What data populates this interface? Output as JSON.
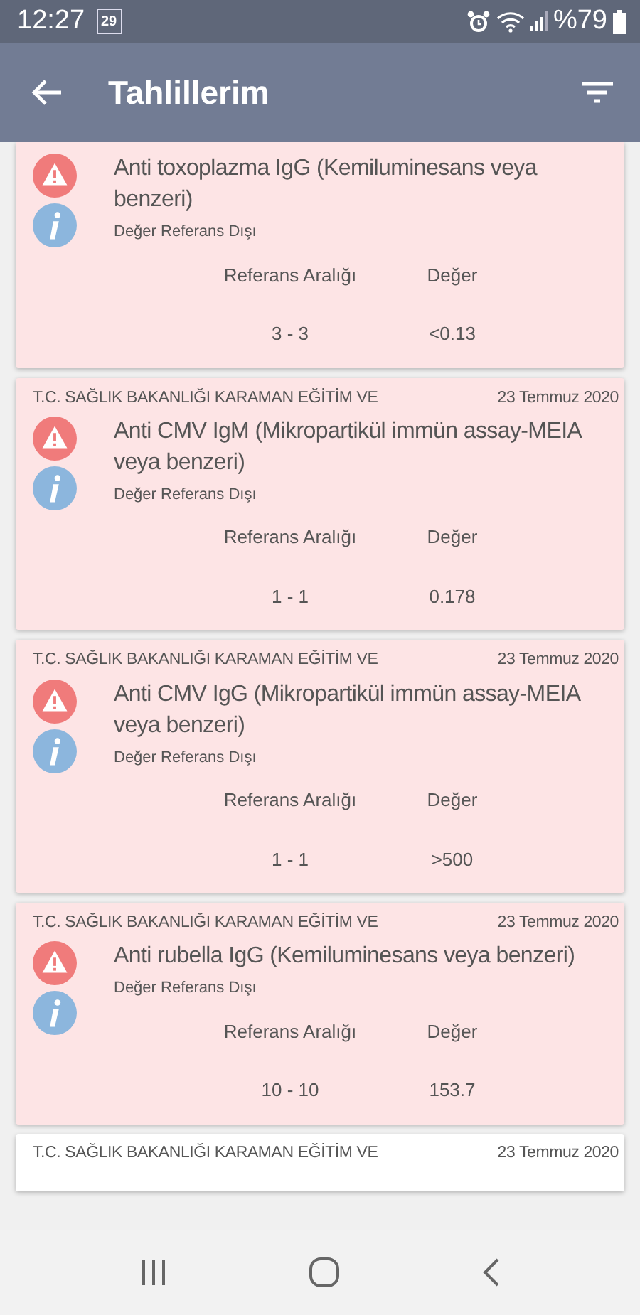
{
  "status_bar": {
    "time": "12:27",
    "calendar_day": "29",
    "battery": "%79"
  },
  "app_bar": {
    "title": "Tahlillerim"
  },
  "results": [
    {
      "flagged": true,
      "test": "Anti toxoplazma IgG (Kemiluminesans veya benzeri)",
      "status": "Değer Referans Dışı",
      "range_label": "Referans Aralığı",
      "value_label": "Değer",
      "range": "3 - 3",
      "value": "<0.13"
    },
    {
      "hospital": "T.C. SAĞLIK BAKANLIĞI KARAMAN EĞİTİM VE",
      "date": "23 Temmuz 2020",
      "flagged": true,
      "test": "Anti CMV IgM (Mikropartikül immün assay-MEIA veya benzeri)",
      "status": "Değer Referans Dışı",
      "range_label": "Referans Aralığı",
      "value_label": "Değer",
      "range": "1 - 1",
      "value": "0.178"
    },
    {
      "hospital": "T.C. SAĞLIK BAKANLIĞI KARAMAN EĞİTİM VE",
      "date": "23 Temmuz 2020",
      "flagged": true,
      "test": "Anti CMV IgG (Mikropartikül immün assay-MEIA veya benzeri)",
      "status": "Değer Referans Dışı",
      "range_label": "Referans Aralığı",
      "value_label": "Değer",
      "range": "1 - 1",
      "value": ">500"
    },
    {
      "hospital": "T.C. SAĞLIK BAKANLIĞI KARAMAN EĞİTİM VE",
      "date": "23 Temmuz 2020",
      "flagged": true,
      "test": "Anti rubella IgG (Kemiluminesans veya benzeri)",
      "status": "Değer Referans Dışı",
      "range_label": "Referans Aralığı",
      "value_label": "Değer",
      "range": "10 - 10",
      "value": "153.7"
    },
    {
      "hospital": "T.C. SAĞLIK BAKANLIĞI KARAMAN EĞİTİM VE",
      "date": "23 Temmuz 2020",
      "flagged": false
    }
  ]
}
